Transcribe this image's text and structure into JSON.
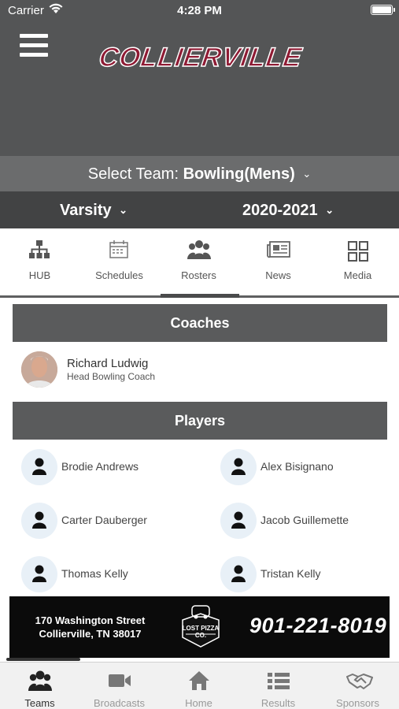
{
  "status": {
    "carrier": "Carrier",
    "time": "4:28 PM"
  },
  "header": {
    "logo_text": "COLLIERVILLE",
    "logo_color": "#8f1b34"
  },
  "team_select": {
    "label": "Select Team:",
    "value": "Bowling(Mens)"
  },
  "level": {
    "value": "Varsity"
  },
  "season": {
    "value": "2020-2021"
  },
  "tabs": [
    {
      "label": "HUB",
      "icon": "hierarchy-icon"
    },
    {
      "label": "Schedules",
      "icon": "calendar-icon"
    },
    {
      "label": "Rosters",
      "icon": "group-icon",
      "active": true
    },
    {
      "label": "News",
      "icon": "newspaper-icon"
    },
    {
      "label": "Media",
      "icon": "grid-icon"
    }
  ],
  "coaches": {
    "title": "Coaches",
    "items": [
      {
        "name": "Richard Ludwig",
        "role": "Head Bowling Coach"
      }
    ]
  },
  "players": {
    "title": "Players",
    "items": [
      {
        "name": "Brodie Andrews"
      },
      {
        "name": "Alex Bisignano"
      },
      {
        "name": "Carter Dauberger"
      },
      {
        "name": "Jacob Guillemette"
      },
      {
        "name": "Thomas Kelly"
      },
      {
        "name": "Tristan Kelly"
      }
    ]
  },
  "sponsor": {
    "address_line1": "170 Washington Street",
    "address_line2": "Collierville, TN 38017",
    "logo_text": "LOST PIZZA CO.",
    "phone": "901-221-8019"
  },
  "bottom_nav": [
    {
      "label": "Teams",
      "icon": "teams-icon",
      "active": true
    },
    {
      "label": "Broadcasts",
      "icon": "video-camera-icon"
    },
    {
      "label": "Home",
      "icon": "home-icon"
    },
    {
      "label": "Results",
      "icon": "list-icon"
    },
    {
      "label": "Sponsors",
      "icon": "handshake-icon"
    }
  ]
}
